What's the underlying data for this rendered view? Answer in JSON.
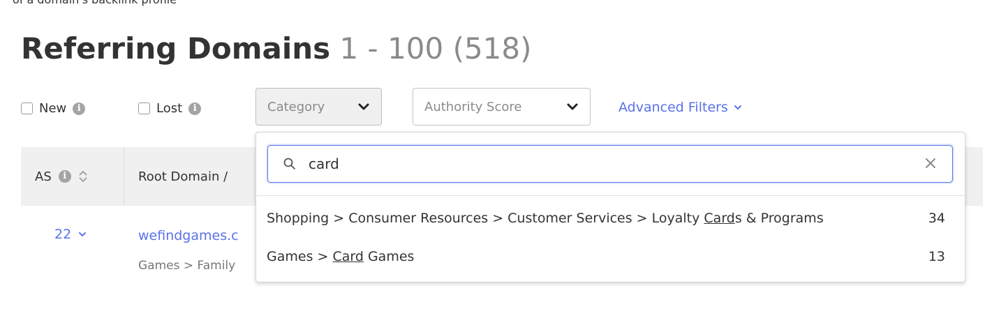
{
  "top_cut_text": "of a domain's backlink profile",
  "header": {
    "title": "Referring Domains",
    "range": "1 - 100 (518)"
  },
  "filters": {
    "new_label": "New",
    "lost_label": "Lost",
    "category_label": "Category",
    "authority_label": "Authority Score",
    "advanced_label": "Advanced Filters"
  },
  "table": {
    "col_as": "AS",
    "col_root": "Root Domain /",
    "row": {
      "as_value": "22",
      "domain": "wefindgames.c",
      "category": "Games > Family"
    }
  },
  "category_popup": {
    "search_value": "card",
    "options": [
      {
        "prefix": "Shopping > Consumer Resources > Customer Services > Loyalty ",
        "match": "Card",
        "suffix": "s & Programs",
        "count": "34"
      },
      {
        "prefix": "Games > ",
        "match": "Card",
        "suffix": " Games",
        "count": "13"
      }
    ]
  },
  "colors": {
    "accent": "#5a72e8",
    "muted": "#8a8a8a",
    "header_bg": "#f0f0f0"
  }
}
